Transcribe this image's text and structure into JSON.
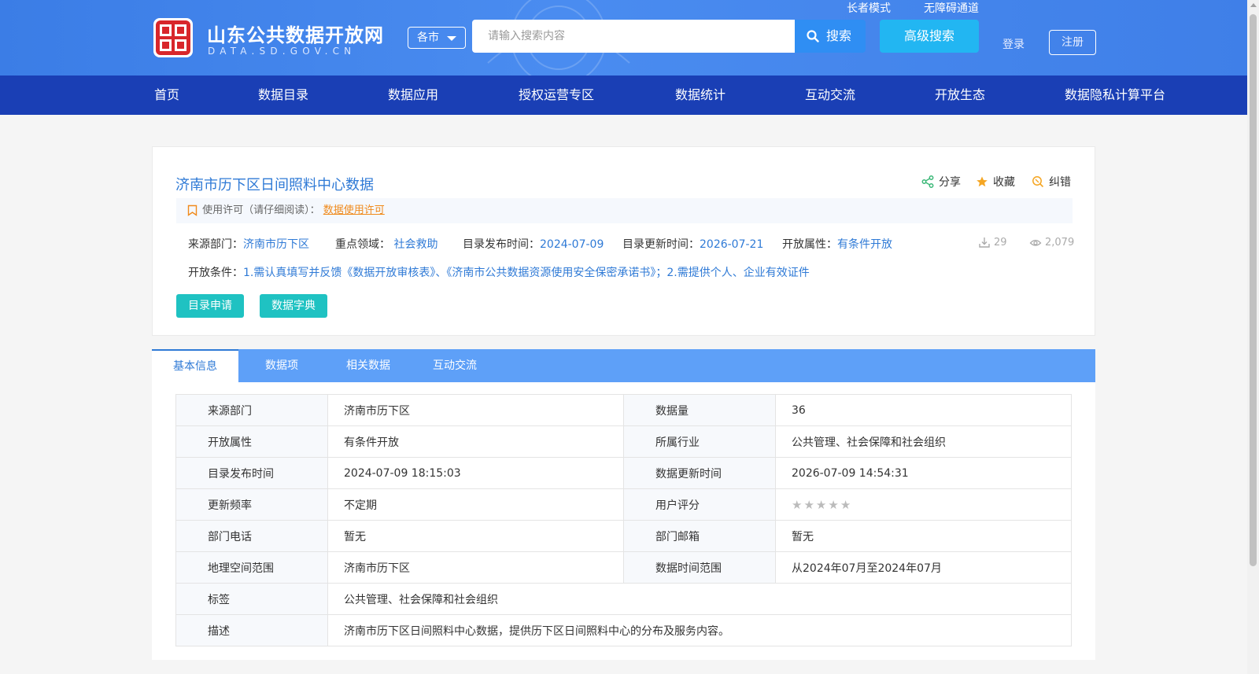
{
  "header": {
    "site_title": "山东公共数据开放网",
    "site_sub": "DATA.SD.GOV.CN",
    "city_select": "各市",
    "search_placeholder": "请输入搜索内容",
    "search_label": "搜索",
    "advanced_search": "高级搜索",
    "elder_mode": "长者模式",
    "accessibility": "无障碍通道",
    "login": "登录",
    "register": "注册"
  },
  "nav": {
    "items": [
      "首页",
      "数据目录",
      "数据应用",
      "授权运营专区",
      "数据统计",
      "互动交流",
      "开放生态",
      "数据隐私计算平台"
    ]
  },
  "detail": {
    "title": "济南市历下区日间照料中心数据",
    "share": "分享",
    "favorite": "收藏",
    "report_error": "纠错",
    "license_label": "使用许可（请仔细阅读）：",
    "license_link": "数据使用许可",
    "source_dept_label": "来源部门：",
    "source_dept": "济南市历下区",
    "key_area_label": "重点领域：",
    "key_area": "社会救助",
    "publish_time_label": "目录发布时间：",
    "publish_time": "2024-07-09",
    "update_time_label": "目录更新时间：",
    "update_time": "2026-07-21",
    "open_attr_label": "开放属性：",
    "open_attr": "有条件开放",
    "download_count": "29",
    "view_count": "2,079",
    "condition_label": "开放条件：",
    "condition": "1.需认真填写并反馈《数据开放审核表》、《济南市公共数据资源使用安全保密承诺书》；2.需提供个人、企业有效证件",
    "apply_button": "目录申请",
    "dictionary_button": "数据字典"
  },
  "tabs": [
    "基本信息",
    "数据项",
    "相关数据",
    "互动交流"
  ],
  "info": {
    "source_dept_k": "来源部门",
    "source_dept_v": "济南市历下区",
    "data_volume_k": "数据量",
    "data_volume_v": "36",
    "open_attr_k": "开放属性",
    "open_attr_v": "有条件开放",
    "industry_k": "所属行业",
    "industry_v": "公共管理、社会保障和社会组织",
    "publish_k": "目录发布时间",
    "publish_v": "2024-07-09 18:15:03",
    "data_update_k": "数据更新时间",
    "data_update_v": "2026-07-09 14:54:31",
    "freq_k": "更新频率",
    "freq_v": "不定期",
    "rating_k": "用户评分",
    "rating_stars_filled": 0,
    "rating_stars_total": 5,
    "phone_k": "部门电话",
    "phone_v": "暂无",
    "email_k": "部门邮箱",
    "email_v": "暂无",
    "geo_k": "地理空间范围",
    "geo_v": "济南市历下区",
    "time_range_k": "数据时间范围",
    "time_range_v": "从2024年07月至2024年07月",
    "tags_k": "标签",
    "tags_v": "公共管理、社会保障和社会组织",
    "desc_k": "描述",
    "desc_v": "济南市历下区日间照料中心数据，提供历下区日间照料中心的分布及服务内容。"
  },
  "colors": {
    "header_blue": "#4a8cf0",
    "nav_blue": "#1a3fb5",
    "link_blue": "#2f7ad6",
    "teal_button": "#1fc2c2",
    "license_orange": "#f08a1c",
    "tab_bar_blue": "#5ea0f8"
  }
}
